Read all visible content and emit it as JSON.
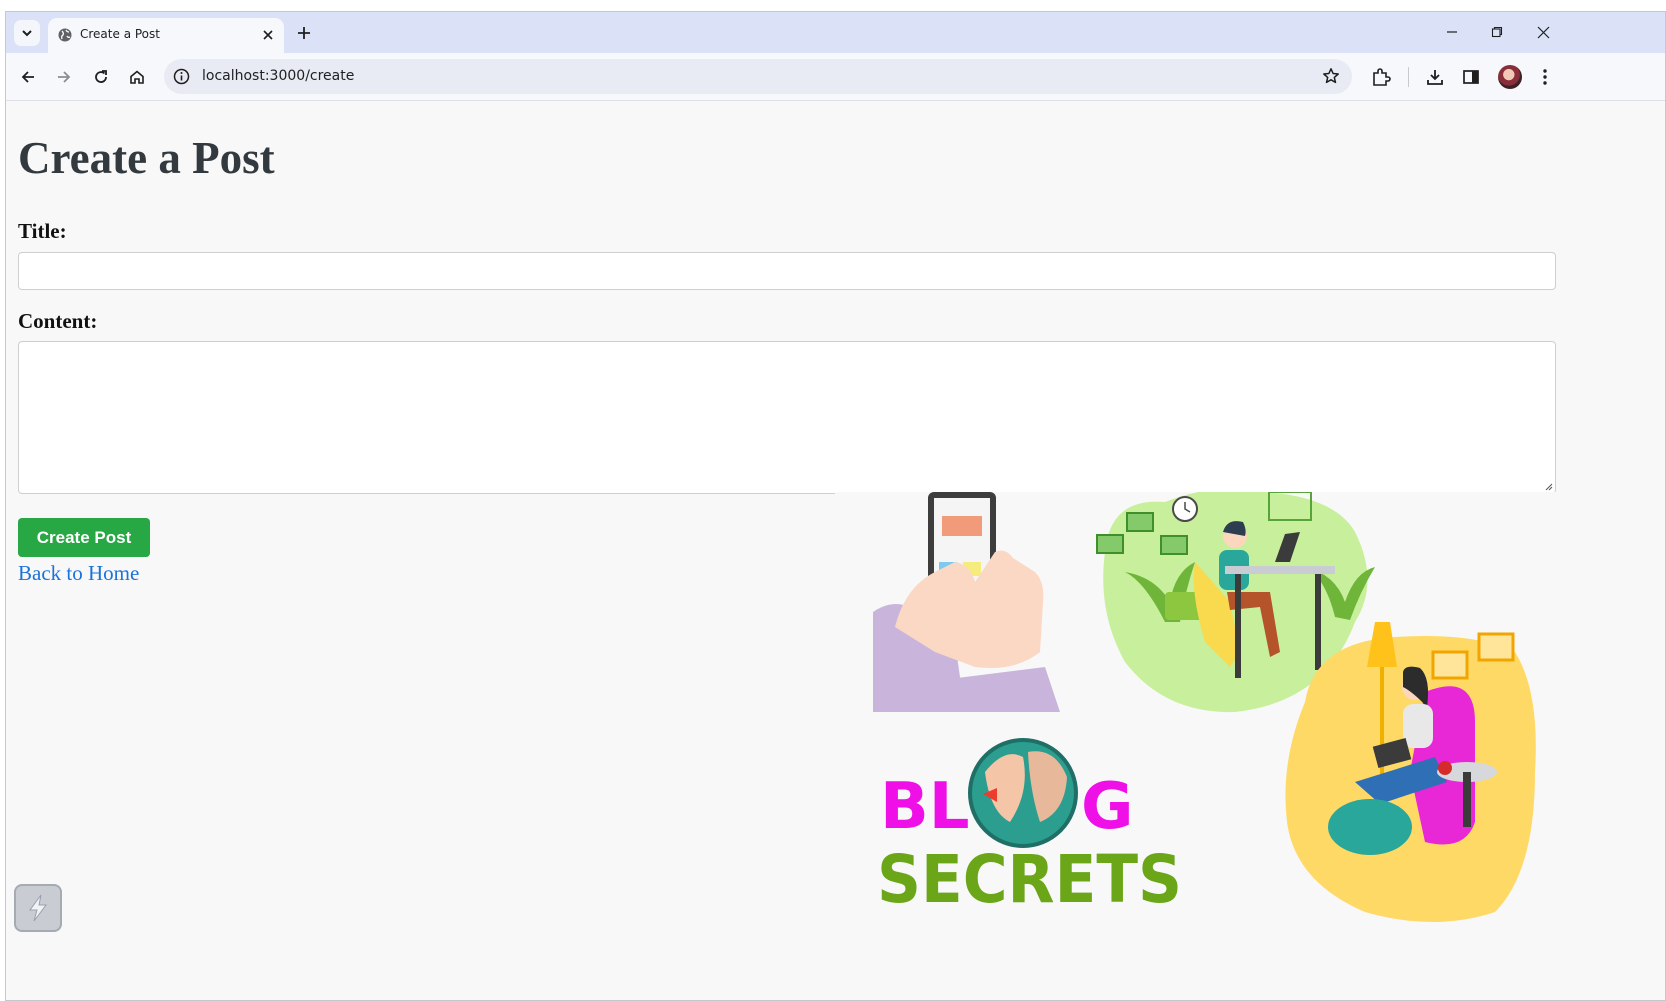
{
  "browser": {
    "tab_title": "Create a Post",
    "url": "localhost:3000/create"
  },
  "page": {
    "heading": "Create a Post",
    "title_label": "Title:",
    "title_value": "",
    "content_label": "Content:",
    "content_value": "",
    "submit_label": "Create Post",
    "back_link": "Back to Home",
    "submit_color": "#28a745",
    "link_color": "#1a73d9"
  },
  "illustration": {
    "logo_line1_left": "BL",
    "logo_line1_right": "G",
    "logo_line2": "SECRETS",
    "logo_colors": {
      "blog": "#ee10e6",
      "secrets": "#6aa618"
    }
  },
  "icons": [
    "tab-search-icon",
    "globe-icon",
    "close-icon",
    "plus-icon",
    "minimize-icon",
    "restore-icon",
    "back-arrow-icon",
    "forward-arrow-icon",
    "reload-icon",
    "home-icon",
    "info-icon",
    "star-icon",
    "extensions-icon",
    "download-icon",
    "side-panel-icon",
    "menu-dots-icon"
  ]
}
